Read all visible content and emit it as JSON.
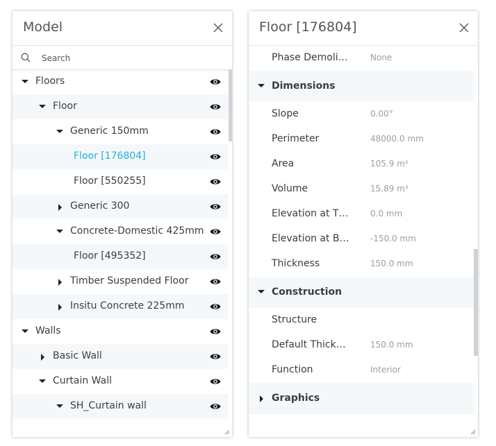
{
  "model_panel": {
    "title": "Model",
    "search_placeholder": "Search",
    "tree": [
      {
        "label": "Floors",
        "level": 0,
        "expanded": true
      },
      {
        "label": "Floor",
        "level": 1,
        "expanded": true
      },
      {
        "label": "Generic 150mm",
        "level": 2,
        "expanded": true
      },
      {
        "label": "Floor [176804]",
        "level": 3,
        "selected": true
      },
      {
        "label": "Floor [550255]",
        "level": 3
      },
      {
        "label": "Generic 300",
        "level": 2,
        "expanded": false
      },
      {
        "label": "Concrete-Domestic 425mm",
        "level": 2,
        "expanded": true
      },
      {
        "label": "Floor [495352]",
        "level": 3
      },
      {
        "label": "Timber Suspended Floor",
        "level": 2,
        "expanded": false
      },
      {
        "label": "Insitu Concrete 225mm",
        "level": 2,
        "expanded": false
      },
      {
        "label": "Walls",
        "level": 0,
        "expanded": true
      },
      {
        "label": "Basic Wall",
        "level": 1,
        "expanded": false
      },
      {
        "label": "Curtain Wall",
        "level": 1,
        "expanded": true
      },
      {
        "label": "SH_Curtain wall",
        "level": 2,
        "expanded": true
      }
    ]
  },
  "props_panel": {
    "title": "Floor [176804]",
    "rows": [
      {
        "type": "prop",
        "name": "Phase Demoli…",
        "value": "None"
      },
      {
        "type": "section",
        "name": "Dimensions",
        "expanded": true
      },
      {
        "type": "prop",
        "name": "Slope",
        "value": "0.00°"
      },
      {
        "type": "prop",
        "name": "Perimeter",
        "value": "48000.0 mm"
      },
      {
        "type": "prop",
        "name": "Area",
        "value": "105.9 m²"
      },
      {
        "type": "prop",
        "name": "Volume",
        "value": "15.89 m³"
      },
      {
        "type": "prop",
        "name": "Elevation at T…",
        "value": "0.0 mm"
      },
      {
        "type": "prop",
        "name": "Elevation at B…",
        "value": "-150.0 mm"
      },
      {
        "type": "prop",
        "name": "Thickness",
        "value": "150.0 mm"
      },
      {
        "type": "section",
        "name": "Construction",
        "expanded": true
      },
      {
        "type": "prop",
        "name": "Structure",
        "value": ""
      },
      {
        "type": "prop",
        "name": "Default Thick…",
        "value": "150.0 mm"
      },
      {
        "type": "prop",
        "name": "Function",
        "value": "Interior"
      },
      {
        "type": "section",
        "name": "Graphics",
        "expanded": false
      }
    ]
  },
  "colors": {
    "selected_text": "#1ab3dc",
    "row_alt_bg": "#f5f8fa",
    "muted_value": "#9a9ea3"
  }
}
